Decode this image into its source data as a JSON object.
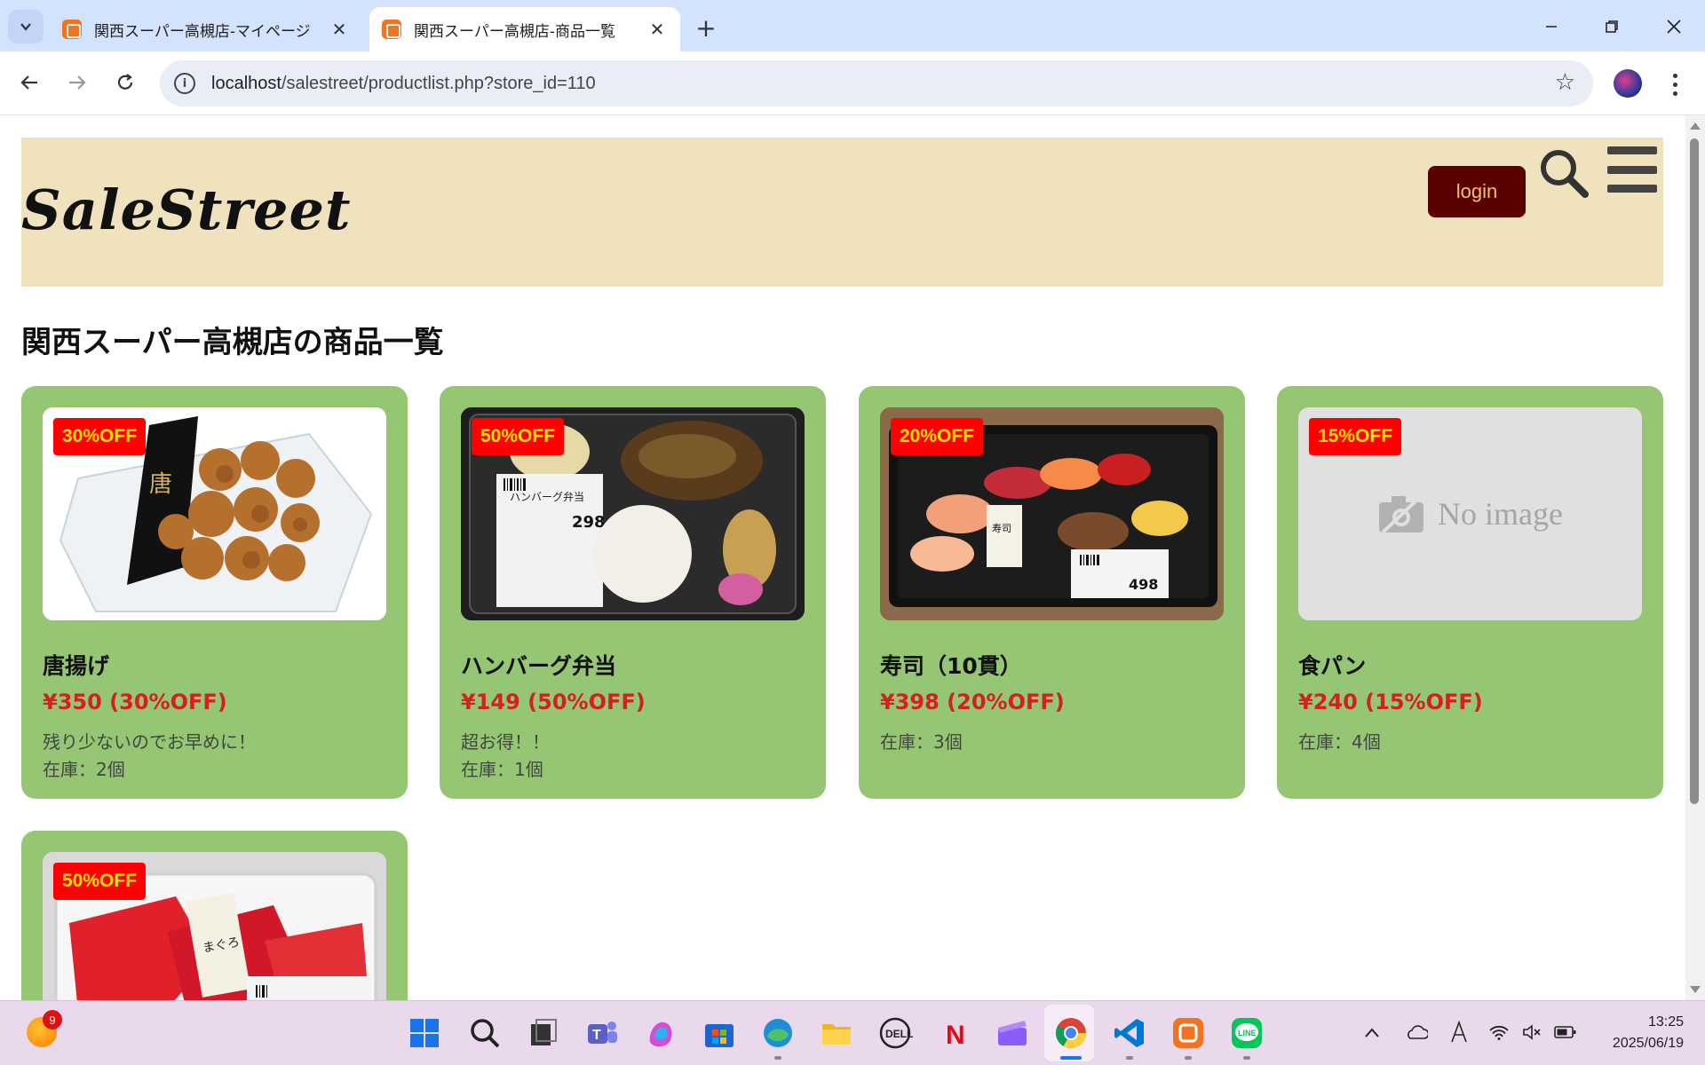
{
  "browser": {
    "tabs": [
      {
        "title": "関西スーパー高槻店-マイページ",
        "active": false
      },
      {
        "title": "関西スーパー高槻店-商品一覧",
        "active": true
      }
    ],
    "url_host": "localhost",
    "url_path": "/salestreet/productlist.php?store_id=110"
  },
  "site": {
    "logo": "SaleStreet",
    "login_label": "login",
    "page_title": "関西スーパー高槻店の商品一覧",
    "accent_header": "#efe2bd",
    "card_color": "#95c674"
  },
  "products": [
    {
      "badge": "30%OFF",
      "name": "唐揚げ",
      "price": "¥350 (30%OFF)",
      "desc": "残り少ないのでお早めに！",
      "stock": "在庫：2個",
      "image": "karaage"
    },
    {
      "badge": "50%OFF",
      "name": "ハンバーグ弁当",
      "price": "¥149 (50%OFF)",
      "desc": "超お得！！",
      "stock": "在庫：1個",
      "image": "hamburg-bento"
    },
    {
      "badge": "20%OFF",
      "name": "寿司（10貫）",
      "price": "¥398 (20%OFF)",
      "desc": "",
      "stock": "在庫：3個",
      "image": "sushi"
    },
    {
      "badge": "15%OFF",
      "name": "食パン",
      "price": "¥240 (15%OFF)",
      "desc": "",
      "stock": "在庫：4個",
      "image": "no-image",
      "no_image_label": "No image"
    },
    {
      "badge": "50%OFF",
      "name": "",
      "price": "",
      "desc": "",
      "stock": "",
      "image": "maguro"
    }
  ],
  "taskbar": {
    "weather_badge": "9",
    "time": "13:25",
    "date": "2025/06/19"
  }
}
